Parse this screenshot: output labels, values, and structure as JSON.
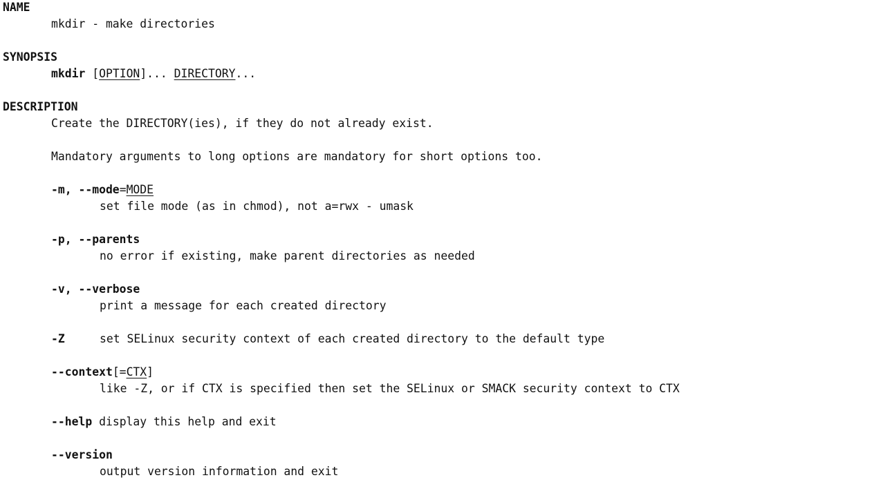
{
  "name": {
    "heading": "NAME",
    "text": "mkdir - make directories"
  },
  "synopsis": {
    "heading": "SYNOPSIS",
    "cmd": "mkdir",
    "sp1": " [",
    "opt": "OPTION",
    "sp2": "]... ",
    "dir": "DIRECTORY",
    "tail": "..."
  },
  "description": {
    "heading": "DESCRIPTION",
    "line1": "Create the DIRECTORY(ies), if they do not already exist.",
    "line2": "Mandatory arguments to long options are mandatory for short options too."
  },
  "options": {
    "mode": {
      "flag": "-m, --mode",
      "eq": "=",
      "arg": "MODE",
      "desc": "set file mode (as in chmod), not a=rwx - umask"
    },
    "parents": {
      "flag": "-p, --parents",
      "desc": "no error if existing, make parent directories as needed"
    },
    "verbose": {
      "flag": "-v, --verbose",
      "desc": "print a message for each created directory"
    },
    "z": {
      "flag": "-Z",
      "desc": "set SELinux security context of each created directory to the default type"
    },
    "context": {
      "flag": "--context",
      "open": "[=",
      "arg": "CTX",
      "close": "]",
      "desc": "like -Z, or if CTX is specified then set the SELinux or SMACK security context to CTX"
    },
    "help": {
      "flag": "--help",
      "desc": " display this help and exit"
    },
    "version": {
      "flag": "--version",
      "desc": "output version information and exit"
    }
  }
}
